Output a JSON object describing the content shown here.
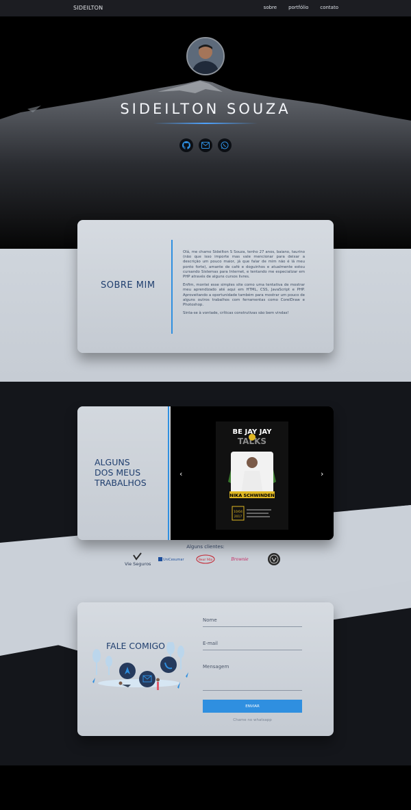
{
  "nav": {
    "brand": "SIDEILTON",
    "links": [
      "sobre",
      "portfólio",
      "contato"
    ]
  },
  "hero": {
    "name": "SIDEILTON SOUZA",
    "socials": [
      "github-icon",
      "mail-icon",
      "whatsapp-icon"
    ]
  },
  "about": {
    "title": "SOBRE MIM",
    "paragraphs": [
      "Olá, me chamo Sideilton S Souza, tenho 27 anos, baiano, taurino (não que isso importe mas vale mencionar para deixar a descrição um pouco maior, já que falar de mim não é lá meu ponto forte), amante de café e doguinhos e atualmente estou cursando Sistemas para Internet, e tentando me especializar em PHP através de alguns cursos livres.",
      "Enfim, montei esse simples site como uma tentativa de mostrar meu aprendizado até aqui em HTML, CSS, JavaScript e PHP. Aproveitando a oportunidade também para mostrar um pouco de alguns outros trabalhos com ferramentas como CorelDraw e Photoshop.",
      "Sinta-se à vontade, críticas construtivas são bem vindas!"
    ]
  },
  "works": {
    "title_lines": [
      "ALGUNS",
      "DOS MEUS",
      "TRABALHOS"
    ],
    "prev": "‹",
    "next": "›",
    "slide": {
      "header": "BE JAY JAY",
      "sub": "TALKS",
      "person": "NIKA SCHWINDEN",
      "date_day": "10/04",
      "date_year": "2017"
    }
  },
  "clients": {
    "label": "Alguns clientes:",
    "logos": [
      "Vie Seguros",
      "UniCesumar",
      "Bear Mix",
      "Brownie",
      "seal"
    ]
  },
  "contact": {
    "title": "FALE COMIGO",
    "name_label": "Nome",
    "email_label": "E-mail",
    "message_label": "Mensagem",
    "send": "ENVIAR",
    "whatsapp": "Chame no whatsapp"
  },
  "colors": {
    "accent": "#2f8fe0",
    "title": "#1f3e6e",
    "dark": "#14161b"
  }
}
